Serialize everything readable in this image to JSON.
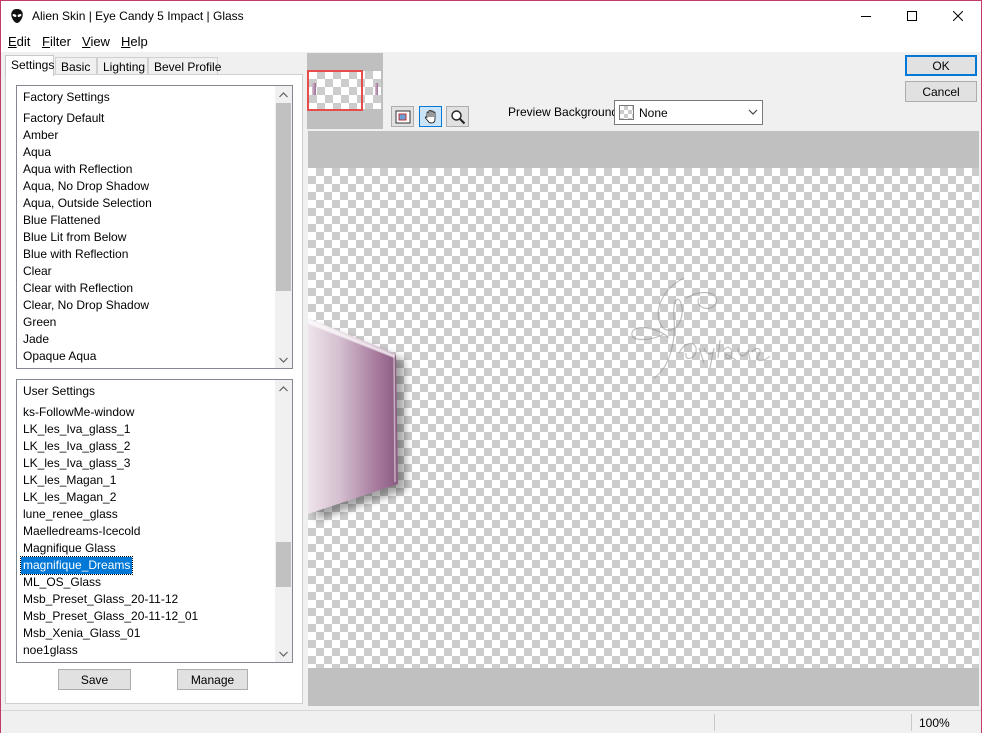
{
  "window": {
    "title": "Alien Skin | Eye Candy 5 Impact | Glass"
  },
  "menu": [
    {
      "label": "Edit",
      "u": "E",
      "rest": "dit"
    },
    {
      "label": "Filter",
      "u": "F",
      "rest": "ilter"
    },
    {
      "label": "View",
      "u": "V",
      "rest": "iew"
    },
    {
      "label": "Help",
      "u": "H",
      "rest": "elp"
    }
  ],
  "tabs": [
    "Settings",
    "Basic",
    "Lighting",
    "Bevel Profile"
  ],
  "factory_settings": {
    "header": "Factory Settings",
    "items": [
      "Factory Default",
      "Amber",
      "Aqua",
      "Aqua with Reflection",
      "Aqua, No Drop Shadow",
      "Aqua, Outside Selection",
      "Blue Flattened",
      "Blue Lit from Below",
      "Blue with Reflection",
      "Clear",
      "Clear with Reflection",
      "Clear, No Drop Shadow",
      "Green",
      "Jade",
      "Opaque Aqua"
    ]
  },
  "user_settings": {
    "header": "User Settings",
    "items": [
      "ks-FollowMe-window",
      "LK_les_Iva_glass_1",
      "LK_les_Iva_glass_2",
      "LK_les_Iva_glass_3",
      "LK_les_Magan_1",
      "LK_les_Magan_2",
      "lune_renee_glass",
      "Maelledreams-Icecold",
      "Magnifique Glass",
      "magnifique_Dreams",
      "ML_OS_Glass",
      "Msb_Preset_Glass_20-11-12",
      "Msb_Preset_Glass_20-11-12_01",
      "Msb_Xenia_Glass_01",
      "noe1glass"
    ],
    "selected": "magnifique_Dreams"
  },
  "buttons": {
    "save": "Save",
    "manage": "Manage",
    "ok": "OK",
    "cancel": "Cancel"
  },
  "preview": {
    "background_label": "Preview Background:",
    "background_value": "None"
  },
  "status": {
    "zoom": "100%"
  },
  "colors": {
    "accent": "#0078d7",
    "selection": "#0078d7",
    "nav_rect": "#e74c4c",
    "window_border": "#c23a6a"
  },
  "icons": [
    "alien-skin-app-icon",
    "minimize-icon",
    "maximize-icon",
    "close-icon",
    "navigator-icon",
    "hand-pan-icon",
    "zoom-icon",
    "chevron-down-icon",
    "scroll-up-icon",
    "scroll-down-icon"
  ]
}
